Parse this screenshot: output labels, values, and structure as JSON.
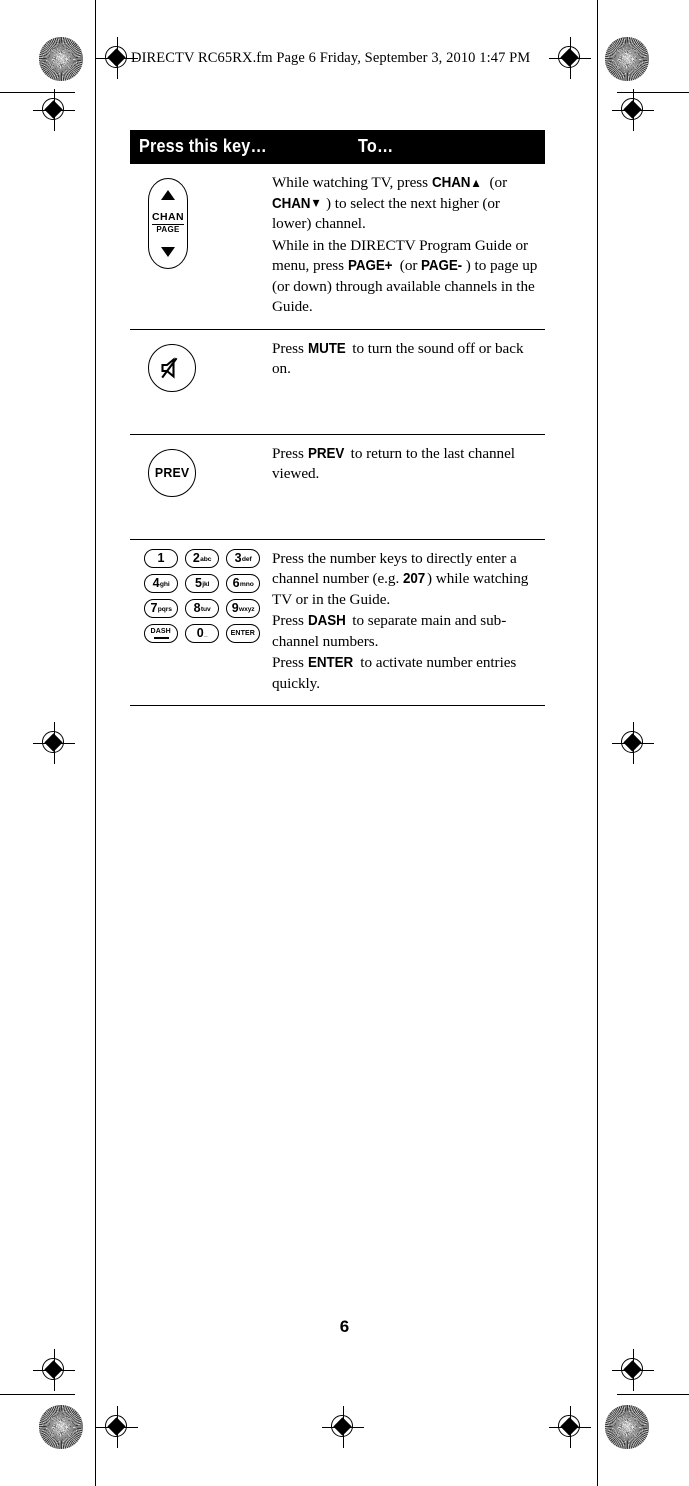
{
  "document": {
    "running_header": "DIRECTV RC65RX.fm  Page 6  Friday, September 3, 2010  1:47 PM",
    "page_number": "6"
  },
  "table": {
    "header": {
      "key_column": "Press this key…",
      "action_column": "To…"
    },
    "rows": [
      {
        "key_art": "chan-page-rocker",
        "key_labels": {
          "chan": "CHAN",
          "page": "PAGE",
          "up_arrow": "▲",
          "down_arrow": "▼"
        },
        "paragraphs": [
          {
            "parts": [
              {
                "t": "While watching TV, press ",
                "b": false
              },
              {
                "t": "CHAN▲",
                "b": true
              },
              {
                "t": " (or ",
                "b": false
              },
              {
                "t": "CHAN▼",
                "b": true
              },
              {
                "t": ") to select the next higher (or lower) channel.",
                "b": false
              }
            ]
          },
          {
            "parts": [
              {
                "t": "While in the DIRECTV Program Guide or menu, press ",
                "b": false
              },
              {
                "t": "PAGE+",
                "b": true
              },
              {
                "t": " (or ",
                "b": false
              },
              {
                "t": "PAGE-",
                "b": true
              },
              {
                "t": ") to page up (or down) through available channels in the Guide.",
                "b": false
              }
            ]
          }
        ]
      },
      {
        "key_art": "mute-circle-button",
        "key_labels": {
          "icon": "muted-speaker-icon"
        },
        "paragraphs": [
          {
            "parts": [
              {
                "t": "Press ",
                "b": false
              },
              {
                "t": "MUTE",
                "b": true
              },
              {
                "t": " to turn the sound off or back on.",
                "b": false
              }
            ]
          }
        ]
      },
      {
        "key_art": "prev-circle-button",
        "key_labels": {
          "text": "PREV"
        },
        "paragraphs": [
          {
            "parts": [
              {
                "t": "Press ",
                "b": false
              },
              {
                "t": "PREV",
                "b": true
              },
              {
                "t": " to return to the last channel viewed.",
                "b": false
              }
            ]
          }
        ]
      },
      {
        "key_art": "numeric-keypad",
        "keypad": [
          [
            {
              "num": "1",
              "sub": ""
            },
            {
              "num": "2",
              "sub": "abc"
            },
            {
              "num": "3",
              "sub": "def"
            }
          ],
          [
            {
              "num": "4",
              "sub": "ghi"
            },
            {
              "num": "5",
              "sub": "jkl"
            },
            {
              "num": "6",
              "sub": "mno"
            }
          ],
          [
            {
              "num": "7",
              "sub": "pqrs"
            },
            {
              "num": "8",
              "sub": "tuv"
            },
            {
              "num": "9",
              "sub": "wxyz"
            }
          ],
          [
            {
              "word": "DASH",
              "bar": true
            },
            {
              "num": "0",
              "sub": "_"
            },
            {
              "word": "ENTER"
            }
          ]
        ],
        "paragraphs": [
          {
            "parts": [
              {
                "t": "Press the number keys to directly enter a channel number (e.g. ",
                "b": false
              },
              {
                "t": "207",
                "b": true
              },
              {
                "t": ") while watching TV or in the Guide.",
                "b": false
              }
            ]
          },
          {
            "parts": [
              {
                "t": "Press ",
                "b": false
              },
              {
                "t": "DASH",
                "b": true
              },
              {
                "t": " to separate main and sub-channel numbers.",
                "b": false
              }
            ]
          },
          {
            "parts": [
              {
                "t": "Press ",
                "b": false
              },
              {
                "t": "ENTER",
                "b": true
              },
              {
                "t": " to activate number entries quickly.",
                "b": false
              }
            ]
          }
        ]
      }
    ]
  },
  "print_marks": {
    "registration": "registration-target",
    "rosette": "color-rosette"
  },
  "colors": {
    "ink": "#000000",
    "paper": "#ffffff",
    "header_bar": "#000000",
    "header_text": "#ffffff"
  }
}
